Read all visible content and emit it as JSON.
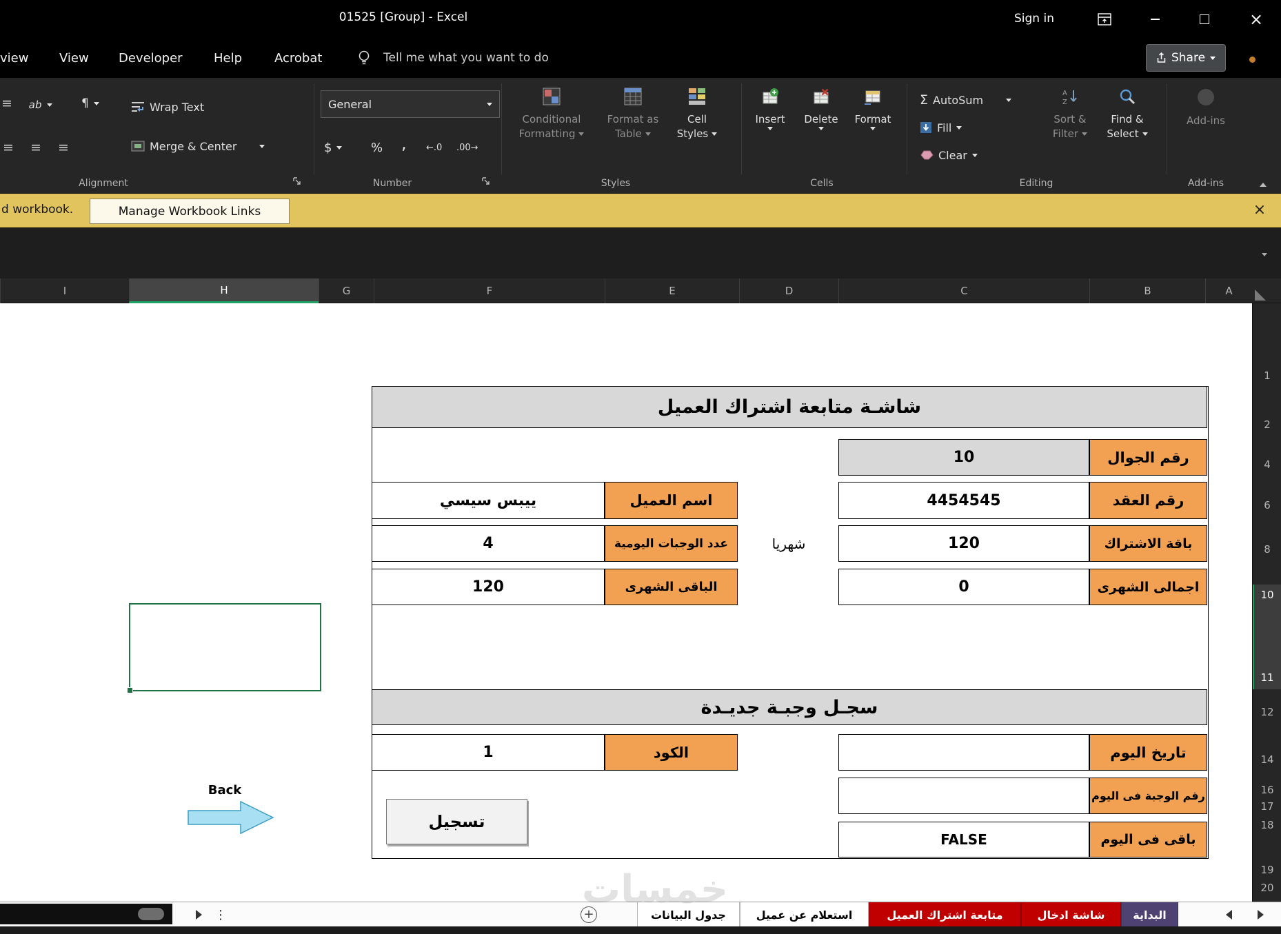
{
  "titlebar": {
    "title": "01525  [Group]  -  Excel",
    "sign_in": "Sign in"
  },
  "menubar": {
    "clipped_tab": "view",
    "view": "View",
    "developer": "Developer",
    "help": "Help",
    "acrobat": "Acrobat",
    "tell_me": "Tell me what you want to do",
    "share": "Share"
  },
  "ribbon": {
    "wrap_text": "Wrap Text",
    "merge_center": "Merge & Center",
    "alignment_label": "Alignment",
    "number_format": "General",
    "currency_icon": "$",
    "percent_icon": "%",
    "comma_icon": ",",
    "increase_decimal_icon": "←.0",
    "decrease_decimal_icon": ".00→",
    "number_label": "Number",
    "conditional_formatting_1": "Conditional",
    "conditional_formatting_2": "Formatting",
    "format_as_table_1": "Format as",
    "format_as_table_2": "Table",
    "cell_styles_1": "Cell",
    "cell_styles_2": "Styles",
    "styles_label": "Styles",
    "insert": "Insert",
    "delete": "Delete",
    "format": "Format",
    "cells_label": "Cells",
    "sigma_icon": "Σ",
    "autosum": "AutoSum",
    "fill": "Fill",
    "clear": "Clear",
    "sort_filter_1": "Sort &",
    "sort_filter_2": "Filter",
    "find_select_1": "Find &",
    "find_select_2": "Select",
    "editing_label": "Editing",
    "addins": "Add-ins",
    "addins_group_label": "Add-ins"
  },
  "message_bar": {
    "clipped_text": "d workbook.",
    "button": "Manage Workbook Links"
  },
  "grid": {
    "columns": [
      "I",
      "H",
      "G",
      "F",
      "E",
      "D",
      "C",
      "B",
      "A"
    ],
    "rows": [
      "1",
      "2",
      "4",
      "6",
      "8",
      "10",
      "11",
      "12",
      "14",
      "16",
      "17",
      "18",
      "19",
      "20"
    ]
  },
  "sheet": {
    "title": "شاشـة متابعة اشتراك العميل",
    "mobile_label": "رقم الجوال",
    "mobile_value": "10",
    "contract_label": "رقم العقد",
    "contract_value": "4454545",
    "name_label": "اسم العميل",
    "name_value": "ييبس سيسي",
    "package_label": "باقة الاشتراك",
    "package_value": "120",
    "package_unit": "شهريا",
    "meals_label": "عدد الوجبات اليومية",
    "meals_value": "4",
    "total_label": "اجمالى الشهرى",
    "total_value": "0",
    "remaining_label": "الباقى الشهرى",
    "remaining_value": "120",
    "section2_title": "سجـل وجبـة جديـدة",
    "date_label": "تاريخ اليوم",
    "date_value": "",
    "code_label": "الكود",
    "code_value": "1",
    "meal_no_label": "رقم الوجبة فى اليوم",
    "meal_no_value": "",
    "day_remaining_label": "باقى فى اليوم",
    "day_remaining_value": "FALSE",
    "register_button": "تسجيل",
    "back_label": "Back"
  },
  "sheet_tabs": {
    "data_table": "جدول البيانات",
    "customer_lookup": "استعلام عن عميل",
    "subscription_tracking": "متابعة اشتراك العميل",
    "entry_screen": "شاشة ادخال",
    "home": "البداية"
  },
  "watermark": "خمسات",
  "colors": {
    "accent_green": "#21A366",
    "selection_green": "#1F7244",
    "cell_orange": "#F2A152",
    "tab_red": "#C00000",
    "tab_purple": "#4E4272",
    "message_bar_yellow": "#E2C45F"
  }
}
